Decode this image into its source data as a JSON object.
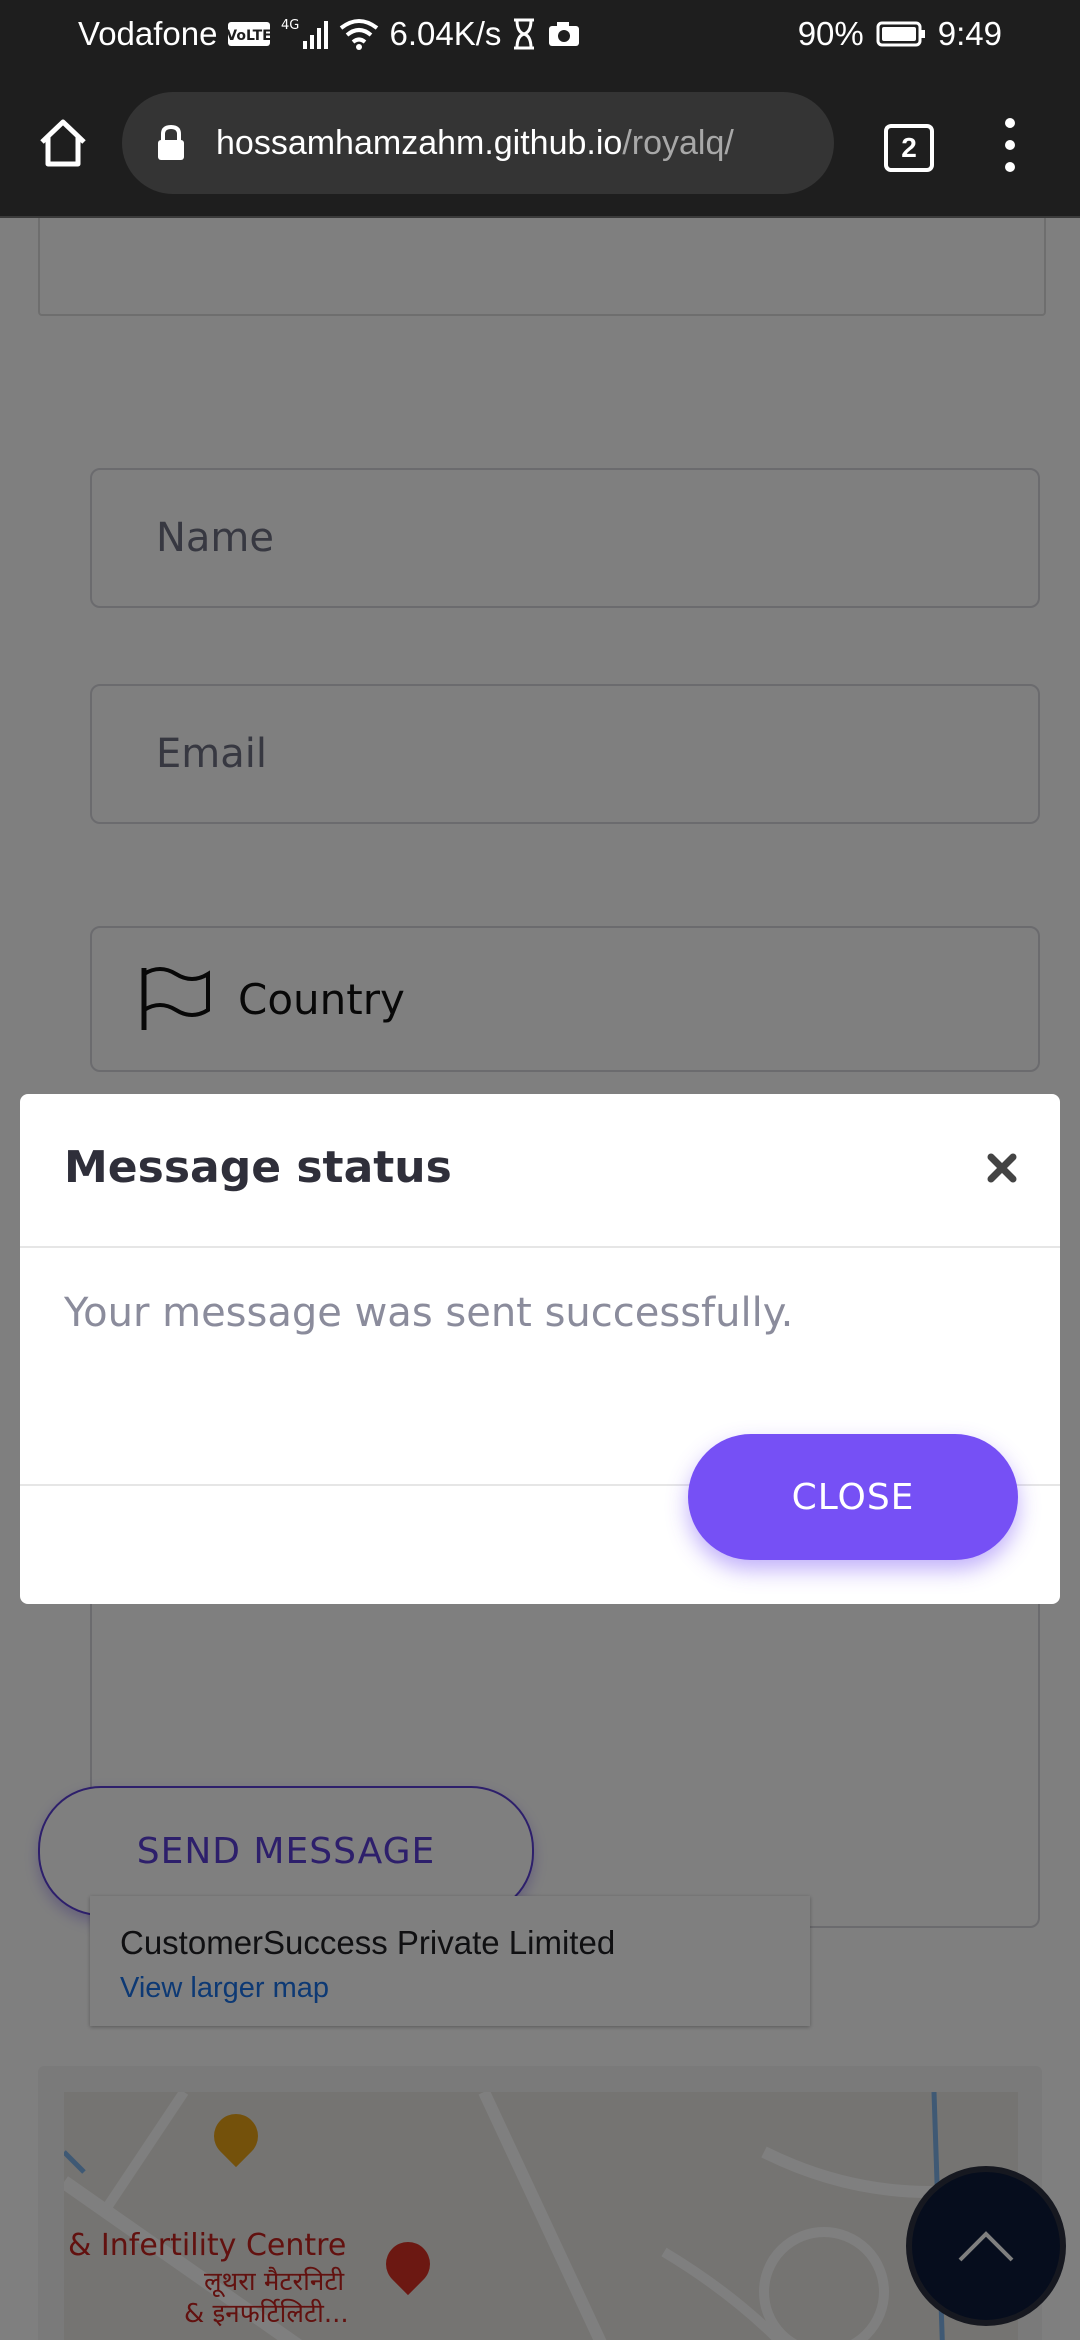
{
  "status_bar": {
    "carrier": "Vodafone",
    "volte_badge": "VoLTE",
    "network_type": "4G",
    "net_speed": "6.04K/s",
    "battery_percent": "90%",
    "time": "9:49",
    "icons": [
      "volte-icon",
      "signal-icon",
      "wifi-icon",
      "hourglass-icon",
      "camera-off-icon",
      "battery-icon"
    ]
  },
  "browser": {
    "url_host": "hossamhamzahm.github.io",
    "url_path": "/royalq/",
    "tab_count": "2"
  },
  "form": {
    "name_placeholder": "Name",
    "email_placeholder": "Email",
    "country_placeholder": "Country",
    "send_button": "SEND MESSAGE"
  },
  "map": {
    "place_title": "CustomerSuccess Private Limited",
    "larger_map_link": "View larger map",
    "label_line1": "& Infertility Centre",
    "label_line2": "लूथरा मैटरनिटी",
    "label_line3": "& इनफर्टिलिटी..."
  },
  "modal": {
    "title": "Message status",
    "message": "Your message was sent successfully.",
    "close_button": "CLOSE"
  },
  "colors": {
    "accent": "#7650f5",
    "send_text": "#5b3fd6",
    "scroll_top_bg": "#0d1b3a"
  }
}
